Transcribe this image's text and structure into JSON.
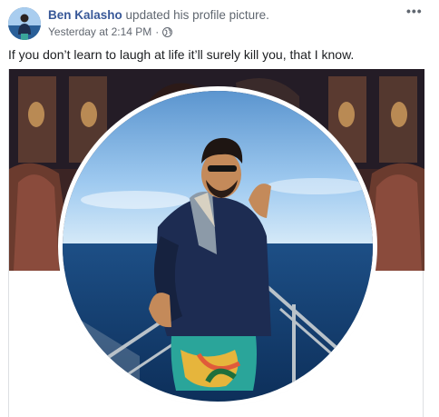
{
  "post": {
    "author_name": "Ben Kalasho",
    "action_text": "updated his profile picture.",
    "timestamp": "Yesterday at 2:14 PM",
    "separator": "·",
    "more_label": "•••",
    "status_text": "If you don’t learn to laugh at life it’ll surely kill you, that I know."
  },
  "icons": {
    "privacy": "globe-icon",
    "more": "more-options-icon"
  },
  "colors": {
    "author_link": "#385898",
    "meta_text": "#616770",
    "sea": "#1d4f86",
    "sky": "#9fcaf0"
  }
}
